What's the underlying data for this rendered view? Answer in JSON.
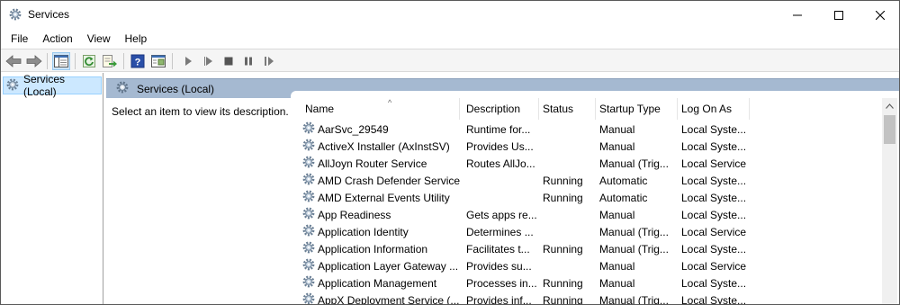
{
  "window": {
    "title": "Services",
    "icon": "gear-icon"
  },
  "menu": [
    "File",
    "Action",
    "View",
    "Help"
  ],
  "toolbar": {
    "buttons": [
      "back-arrow-icon",
      "forward-arrow-icon",
      "show-hide-console-tree-icon",
      "refresh-icon",
      "export-list-icon",
      "help-icon",
      "properties-view-icon",
      "start-service-icon",
      "start-service-alt-icon",
      "stop-service-icon",
      "pause-service-icon",
      "resume-service-icon"
    ]
  },
  "tree": {
    "item_label": "Services (Local)"
  },
  "content": {
    "header_label": "Services (Local)",
    "description_text": "Select an item to view its description."
  },
  "columns": [
    "Name",
    "Description",
    "Status",
    "Startup Type",
    "Log On As"
  ],
  "rows": [
    {
      "name": "AarSvc_29549",
      "description": "Runtime for...",
      "status": "",
      "startup": "Manual",
      "logon": "Local Syste..."
    },
    {
      "name": "ActiveX Installer (AxInstSV)",
      "description": "Provides Us...",
      "status": "",
      "startup": "Manual",
      "logon": "Local Syste..."
    },
    {
      "name": "AllJoyn Router Service",
      "description": "Routes AllJo...",
      "status": "",
      "startup": "Manual (Trig...",
      "logon": "Local Service"
    },
    {
      "name": "AMD Crash Defender Service",
      "description": "",
      "status": "Running",
      "startup": "Automatic",
      "logon": "Local Syste..."
    },
    {
      "name": "AMD External Events Utility",
      "description": "",
      "status": "Running",
      "startup": "Automatic",
      "logon": "Local Syste..."
    },
    {
      "name": "App Readiness",
      "description": "Gets apps re...",
      "status": "",
      "startup": "Manual",
      "logon": "Local Syste..."
    },
    {
      "name": "Application Identity",
      "description": "Determines ...",
      "status": "",
      "startup": "Manual (Trig...",
      "logon": "Local Service"
    },
    {
      "name": "Application Information",
      "description": "Facilitates t...",
      "status": "Running",
      "startup": "Manual (Trig...",
      "logon": "Local Syste..."
    },
    {
      "name": "Application Layer Gateway ...",
      "description": "Provides su...",
      "status": "",
      "startup": "Manual",
      "logon": "Local Service"
    },
    {
      "name": "Application Management",
      "description": "Processes in...",
      "status": "Running",
      "startup": "Manual",
      "logon": "Local Syste..."
    },
    {
      "name": "AppX Deployment Service (...",
      "description": "Provides inf...",
      "status": "Running",
      "startup": "Manual (Trig...",
      "logon": "Local Syste..."
    }
  ]
}
